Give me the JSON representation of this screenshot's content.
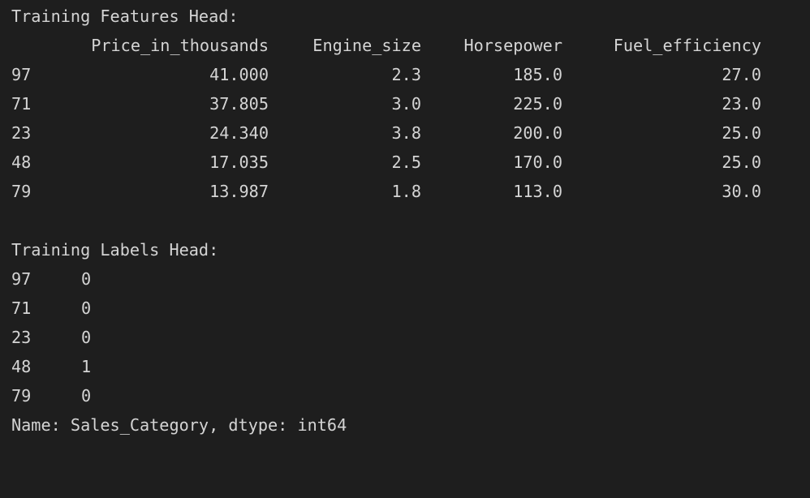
{
  "features": {
    "heading": "Training Features Head:",
    "columns": [
      "Price_in_thousands",
      "Engine_size",
      "Horsepower",
      "Fuel_efficiency"
    ],
    "rows": [
      {
        "index": "97",
        "values": [
          "41.000",
          "2.3",
          "185.0",
          "27.0"
        ]
      },
      {
        "index": "71",
        "values": [
          "37.805",
          "3.0",
          "225.0",
          "23.0"
        ]
      },
      {
        "index": "23",
        "values": [
          "24.340",
          "3.8",
          "200.0",
          "25.0"
        ]
      },
      {
        "index": "48",
        "values": [
          "17.035",
          "2.5",
          "170.0",
          "25.0"
        ]
      },
      {
        "index": "79",
        "values": [
          "13.987",
          "1.8",
          "113.0",
          "30.0"
        ]
      }
    ]
  },
  "labels": {
    "heading": "Training Labels Head:",
    "rows": [
      {
        "index": "97",
        "value": "0"
      },
      {
        "index": "71",
        "value": "0"
      },
      {
        "index": "23",
        "value": "0"
      },
      {
        "index": "48",
        "value": "1"
      },
      {
        "index": "79",
        "value": "0"
      }
    ],
    "footer": "Name: Sales_Category, dtype: int64"
  },
  "colors": {
    "background": "#1e1e1e",
    "text": "#d4d4d4"
  }
}
